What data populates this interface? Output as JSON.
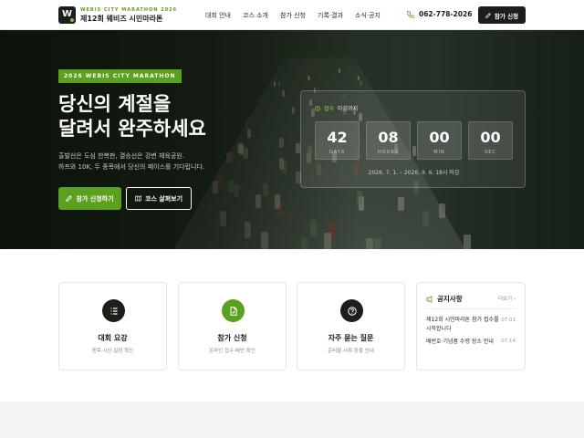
{
  "header": {
    "logo_letter": "W",
    "logo_sub": "WEBIS CITY MARATHON 2026",
    "logo_main": "제12회 웨비즈 시민마라톤",
    "nav": [
      "대회 안내",
      "코스 소개",
      "참가 신청",
      "기록·결과",
      "소식·공지"
    ],
    "phone": "062-778-2026",
    "cta_label": "참가 신청"
  },
  "hero": {
    "badge": "2026 WEBIS CITY MARATHON",
    "title_line1": "당신의 계절을",
    "title_line2": "달려서 완주하세요",
    "desc_line1": "출발선은 도심 한복판, 결승선은 강변 체육공원.",
    "desc_line2": "하프와 10K, 두 종목에서 당신의 페이스를 기다립니다.",
    "apply_label": "참가 신청하기",
    "course_label": "코스 살펴보기"
  },
  "countdown": {
    "label_accent": "접수",
    "label_rest": "마감까지",
    "units": [
      {
        "value": "42",
        "unit": "DAYS"
      },
      {
        "value": "08",
        "unit": "HOURS"
      },
      {
        "value": "00",
        "unit": "MIN"
      },
      {
        "value": "00",
        "unit": "SEC"
      }
    ],
    "range": "2026. 7. 1. – 2026. 9. 6. 18시 마감"
  },
  "cards": [
    {
      "title": "대회 요강",
      "sub": "종목·시상·일정 확인",
      "color": "#1b1f1a"
    },
    {
      "title": "참가 신청",
      "sub": "온라인 접수·배번 확인",
      "color": "#5aa11e"
    },
    {
      "title": "자주 묻는 질문",
      "sub": "준비물·서류·환불 안내",
      "color": "#1b1f1a"
    }
  ],
  "notice": {
    "title": "공지사항",
    "more": "더보기 ›",
    "items": [
      {
        "text": "제12회 시민마라톤 참가 접수를 시작합니다",
        "date": "07.01"
      },
      {
        "text": "배번호·기념품 수령 장소 안내",
        "date": "07.14"
      }
    ]
  },
  "colors": {
    "accent": "#5aa11e",
    "dark": "#1b1f1a"
  }
}
